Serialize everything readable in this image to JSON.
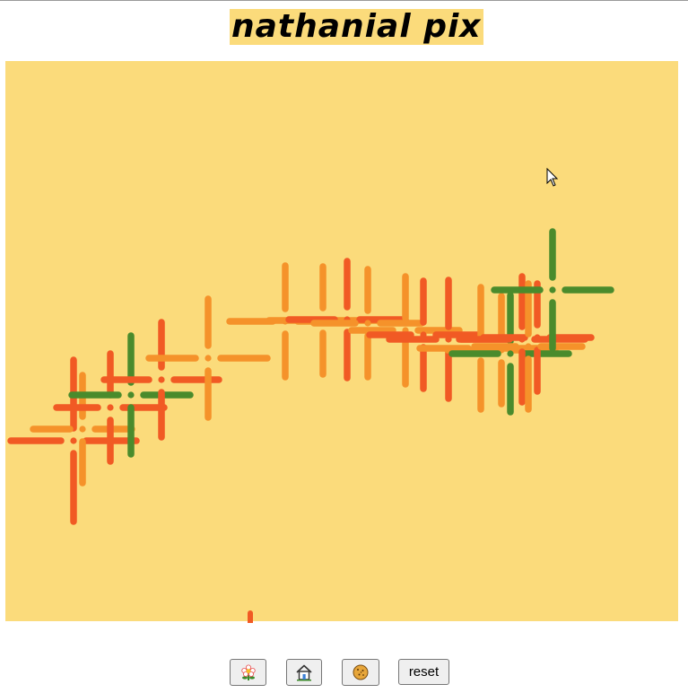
{
  "app": {
    "title": "nathanial pix"
  },
  "colors": {
    "page": "#ffffff",
    "canvas": "#fbdb7b",
    "title_bg": "#fbdb7b",
    "orange": "#f5922a",
    "red_orange": "#f15a24",
    "green": "#4a8b2c"
  },
  "toolbar": {
    "buttons": [
      {
        "name": "flower-button",
        "icon": "flower-icon",
        "label": ""
      },
      {
        "name": "house-button",
        "icon": "house-icon",
        "label": ""
      },
      {
        "name": "cookie-button",
        "icon": "cookie-icon",
        "label": ""
      },
      {
        "name": "reset-button",
        "icon": "",
        "label": "reset"
      }
    ]
  }
}
